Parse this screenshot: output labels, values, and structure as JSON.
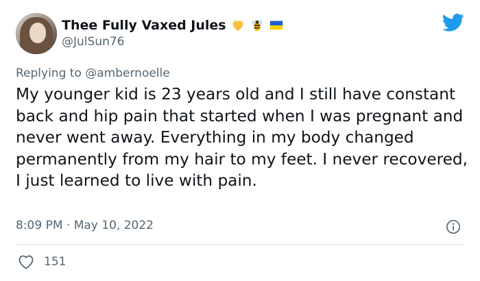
{
  "author": {
    "display_name": "Thee Fully Vaxed Jules",
    "handle": "@JulSun76",
    "emojis": [
      "yellow-heart-icon",
      "bee-icon",
      "ukraine-flag-icon"
    ]
  },
  "reply": {
    "prefix": "Replying to",
    "mention": "@ambernoelle"
  },
  "tweet": {
    "text": "My younger kid is 23 years old and I still have constant back and hip pain that started when I was pregnant and never went away. Everything in my body changed permanently from my hair to my feet. I never recovered, I just learned to live with pain.",
    "timestamp": "8:09 PM · May 10, 2022"
  },
  "engagement": {
    "likes": "151"
  },
  "colors": {
    "brand": "#1d9bf0",
    "secondary_text": "#536471",
    "divider": "#cfd9de"
  }
}
